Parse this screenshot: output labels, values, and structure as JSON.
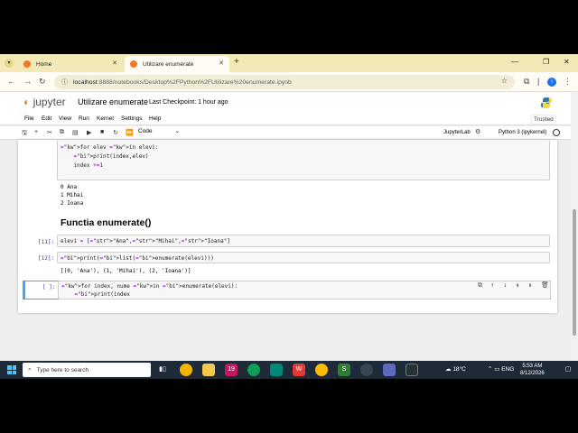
{
  "browser": {
    "tabs": [
      {
        "label": "Home"
      },
      {
        "label": "Utilizare enumerate"
      }
    ],
    "new_tab": "+",
    "url_host": "localhost",
    "url_rest": ":8888/notebooks/Desktop%2FPython%2FUtilizare%20enumerate.ipynb",
    "profile_initial": "i"
  },
  "jupyter": {
    "logo_text": "jupyter",
    "notebook_title": "Utilizare enumerate",
    "checkpoint": "Last Checkpoint: 1 hour ago",
    "menu": [
      "File",
      "Edit",
      "View",
      "Run",
      "Kernel",
      "Settings",
      "Help"
    ],
    "trusted": "Trusted",
    "cell_type": "Code",
    "jupyterlab_link": "JupyterLab",
    "kernel": "Python 3 (ipykernel)"
  },
  "cells": {
    "cell1_lines": [
      "for elev in elevi:",
      "    print(index,elev)",
      "    index +=1"
    ],
    "cell1_output": [
      "0 Ana",
      "1 Mihai",
      "2 Ioana"
    ],
    "heading": "Functia enumerate()",
    "cell2_prompt": "[11]:",
    "cell2_code": "elevi = [\"Ana\",\"Mihai\",\"Ioana\"]",
    "cell3_prompt": "[12]:",
    "cell3_code": "print(list(enumerate(elevi)))",
    "cell3_output": "[(0, 'Ana'), (1, 'Mihai'), (2, 'Ioana')]",
    "cell4_prompt": "[ ]:",
    "cell4_line1": "for index, nume in enumerate(elevi):",
    "cell4_line2": "    print(index"
  },
  "taskbar": {
    "search_placeholder": "Type here to search",
    "weather": "18°C",
    "language": "ENG",
    "time": "5:53 AM",
    "date": "8/12/2026"
  },
  "colors": {
    "tabstrip": "#f3e9b7",
    "jupyter_orange": "#f37726",
    "active_cell": "#42a5f5",
    "taskbar": "#1f2a38"
  }
}
